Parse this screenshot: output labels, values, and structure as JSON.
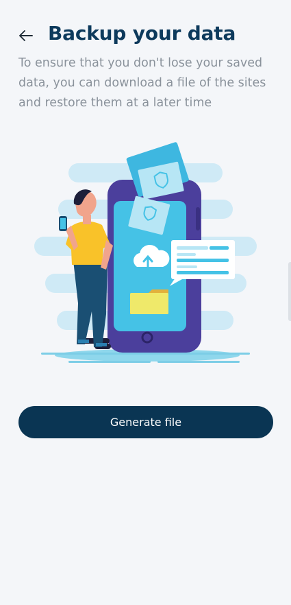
{
  "header": {
    "back_icon": "arrow-left-icon",
    "title": "Backup your data"
  },
  "description": "To ensure that you don't lose your saved data, you can download a file of the sites and restore them at a later time",
  "illustration": {
    "name": "backup-illustration"
  },
  "actions": {
    "generate_label": "Generate file"
  },
  "colors": {
    "background": "#f4f6f9",
    "title": "#0d3a5c",
    "description": "#8a929b",
    "button": "#0a3553",
    "button_text": "#ffffff",
    "phone": "#4b3f9c",
    "screen": "#45c2e6",
    "cloud_bands": "#cfeaf6"
  }
}
